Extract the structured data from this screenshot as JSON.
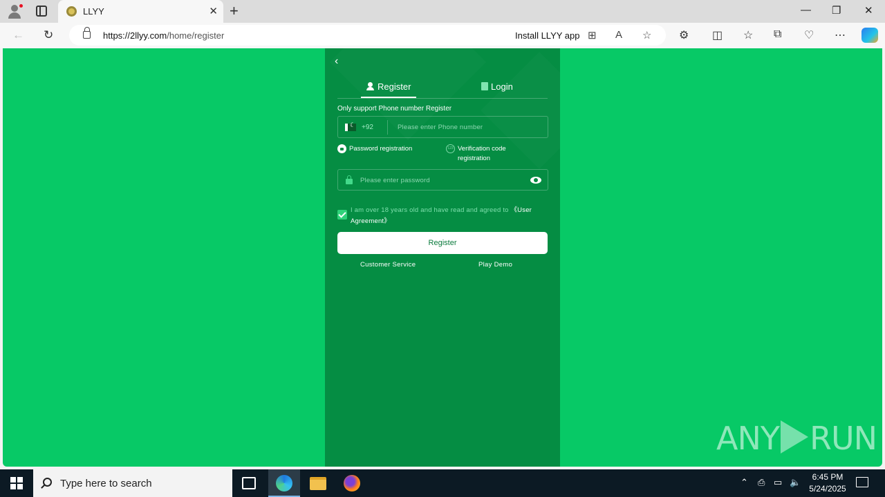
{
  "browser": {
    "tab_title": "LLYY",
    "tab_close": "✕",
    "new_tab": "+",
    "url_host": "https://2llyy.com",
    "url_path": "/home/register",
    "install_label": "Install LLYY app",
    "window_controls": {
      "minimize": "—",
      "restore": "❐",
      "close": "✕"
    }
  },
  "page": {
    "back": "‹",
    "tabs": [
      {
        "label": "Register",
        "active": true
      },
      {
        "label": "Login",
        "active": false
      }
    ],
    "support_hint": "Only support Phone number Register",
    "phone": {
      "country_code": "+92",
      "placeholder": "Please enter Phone number"
    },
    "methods": [
      {
        "label": "Password registration",
        "icon": "lock-circle-icon",
        "selected": true
      },
      {
        "label": "Verification code registration",
        "icon": "123-icon",
        "selected": false
      }
    ],
    "password": {
      "placeholder": "Please enter password"
    },
    "agreement": {
      "text": "I am over 18 years old and have read and agreed to ",
      "link": "《User Agreement》",
      "checked": true
    },
    "register_button": "Register",
    "customer_service": "Customer Service",
    "play_demo": "Play Demo"
  },
  "watermark": {
    "left": "ANY",
    "right": "RUN"
  },
  "taskbar": {
    "search_placeholder": "Type here to search",
    "time": "6:45 PM",
    "date": "5/24/2025"
  },
  "colors": {
    "page_bg": "#07c966",
    "panel_bg": "#058d43",
    "button_text": "#0a7a3c"
  }
}
